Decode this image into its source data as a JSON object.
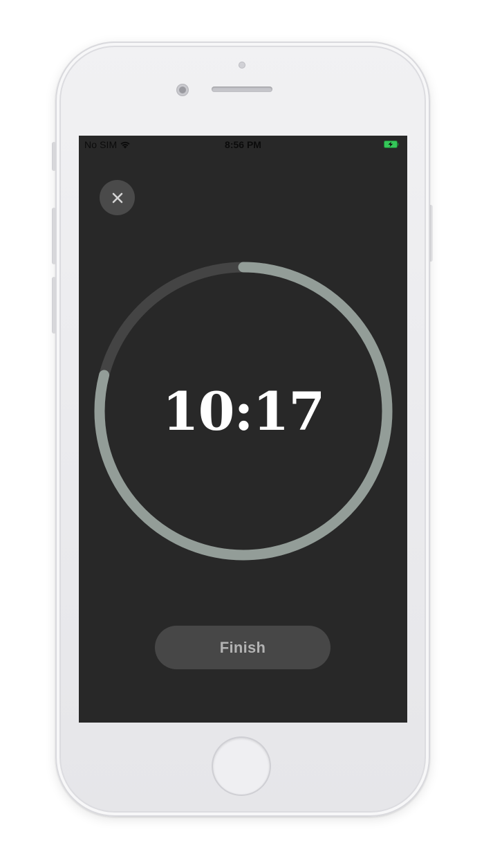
{
  "status_bar": {
    "carrier": "No SIM",
    "wifi_icon": "wifi-icon",
    "time": "8:56 PM",
    "battery_icon": "battery-charging-icon"
  },
  "close_button": {
    "icon": "close-icon"
  },
  "timer": {
    "display": "10:17",
    "progress_fraction": 0.79
  },
  "finish_button": {
    "label": "Finish"
  },
  "colors": {
    "screen_background": "#282828",
    "ring_track": "#444444",
    "ring_progress": "#939d98",
    "button_background": "#474747",
    "button_text": "#b3b3b3",
    "battery_green": "#35c759"
  }
}
